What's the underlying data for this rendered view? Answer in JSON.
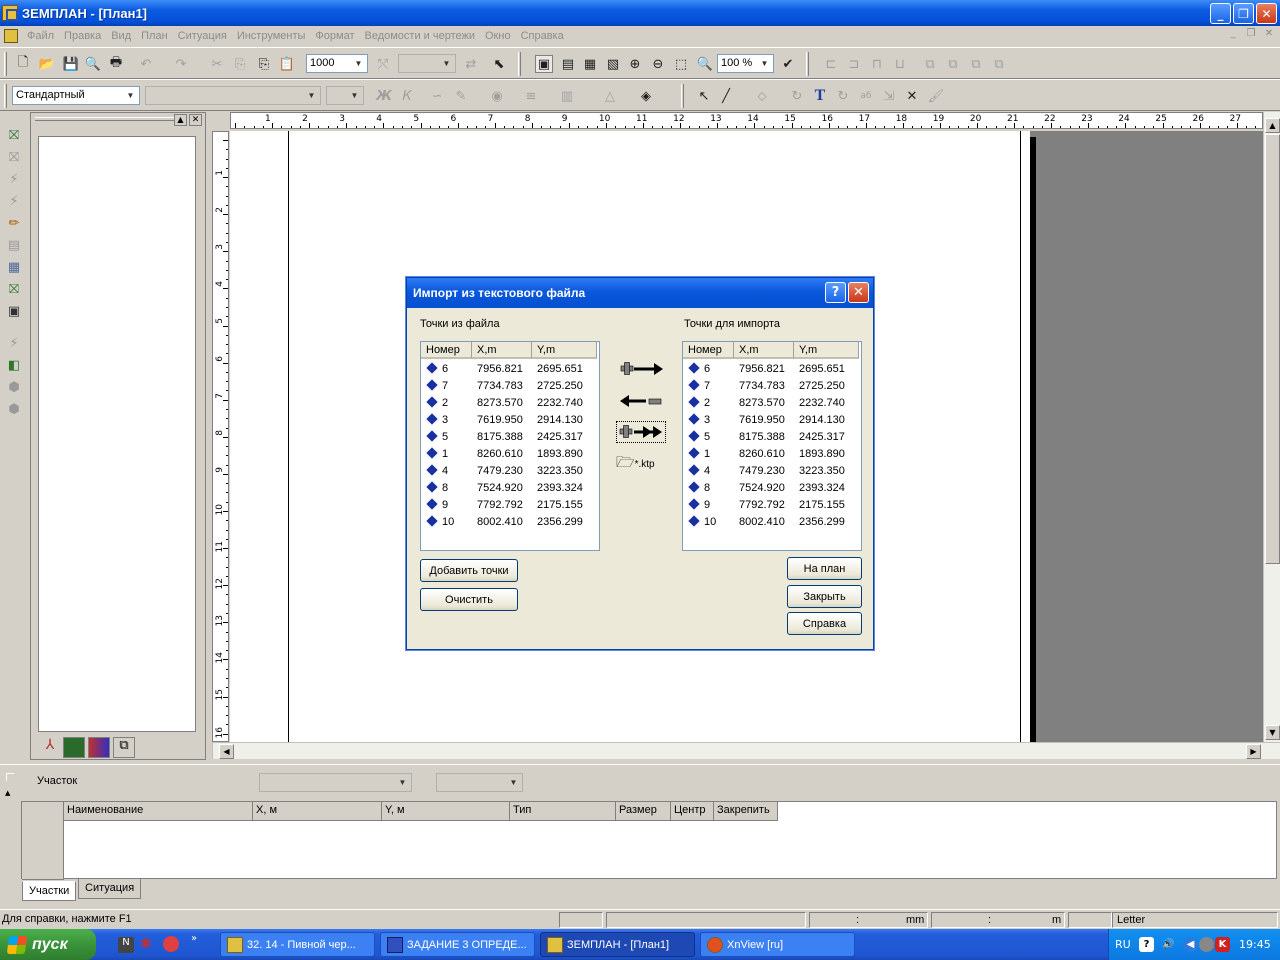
{
  "window": {
    "title": "ЗЕМПЛАН - [План1]"
  },
  "menu": [
    "Файл",
    "Правка",
    "Вид",
    "План",
    "Ситуация",
    "Инструменты",
    "Формат",
    "Ведомости и чертежи",
    "Окно",
    "Справка"
  ],
  "toolbar": {
    "scale_value": "1000",
    "zoom_value": "100 %",
    "style_value": "Стандартный"
  },
  "ruler": {
    "h_labels": [
      "1",
      "2",
      "3",
      "4",
      "5",
      "6",
      "7",
      "8",
      "9",
      "10",
      "11",
      "12",
      "13",
      "14",
      "15",
      "16",
      "17",
      "18",
      "19",
      "20",
      "21",
      "22",
      "23",
      "24",
      "25",
      "26",
      "27"
    ],
    "v_labels": [
      "1",
      "2",
      "3",
      "4",
      "5",
      "6",
      "7",
      "8",
      "9",
      "10",
      "11",
      "12",
      "13",
      "14",
      "15",
      "16"
    ]
  },
  "dialog": {
    "title": "Импорт из текстового файла",
    "left_label": "Точки из файла",
    "right_label": "Точки для импорта",
    "columns": [
      "Номер",
      "X,m",
      "Y,m"
    ],
    "left_points": [
      {
        "n": "6",
        "x": "7956.821",
        "y": "2695.651"
      },
      {
        "n": "7",
        "x": "7734.783",
        "y": "2725.250"
      },
      {
        "n": "2",
        "x": "8273.570",
        "y": "2232.740"
      },
      {
        "n": "3",
        "x": "7619.950",
        "y": "2914.130"
      },
      {
        "n": "5",
        "x": "8175.388",
        "y": "2425.317"
      },
      {
        "n": "1",
        "x": "8260.610",
        "y": "1893.890"
      },
      {
        "n": "4",
        "x": "7479.230",
        "y": "3223.350"
      },
      {
        "n": "8",
        "x": "7524.920",
        "y": "2393.324"
      },
      {
        "n": "9",
        "x": "7792.792",
        "y": "2175.155"
      },
      {
        "n": "10",
        "x": "8002.410",
        "y": "2356.299"
      }
    ],
    "right_points": [
      {
        "n": "6",
        "x": "7956.821",
        "y": "2695.651"
      },
      {
        "n": "7",
        "x": "7734.783",
        "y": "2725.250"
      },
      {
        "n": "2",
        "x": "8273.570",
        "y": "2232.740"
      },
      {
        "n": "3",
        "x": "7619.950",
        "y": "2914.130"
      },
      {
        "n": "5",
        "x": "8175.388",
        "y": "2425.317"
      },
      {
        "n": "1",
        "x": "8260.610",
        "y": "1893.890"
      },
      {
        "n": "4",
        "x": "7479.230",
        "y": "3223.350"
      },
      {
        "n": "8",
        "x": "7524.920",
        "y": "2393.324"
      },
      {
        "n": "9",
        "x": "7792.792",
        "y": "2175.155"
      },
      {
        "n": "10",
        "x": "8002.410",
        "y": "2356.299"
      }
    ],
    "ktp_label": "*.ktp",
    "add_points": "Добавить точки",
    "clear": "Очистить",
    "to_plan": "На план",
    "close": "Закрыть",
    "help": "Справка"
  },
  "bottom": {
    "parcel_label": "Участок",
    "grid_columns": [
      "Наименование",
      "X, м",
      "Y, м",
      "Тип",
      "Размер",
      "Центр",
      "Закрепить"
    ],
    "tabs": [
      "Участки",
      "Ситуация"
    ]
  },
  "status": {
    "help_text": "Для справки, нажмите F1",
    "colon1": ":",
    "unit1": "mm",
    "colon2": ":",
    "unit2": "m",
    "paper": "Letter"
  },
  "taskbar": {
    "start": "пуск",
    "tasks": [
      "32. 14 - Пивной чер...",
      "ЗАДАНИЕ 3 ОПРЕДЕ...",
      "ЗЕМПЛАН - [План1]",
      "XnView [ru]"
    ],
    "lang": "RU",
    "time": "19:45"
  }
}
